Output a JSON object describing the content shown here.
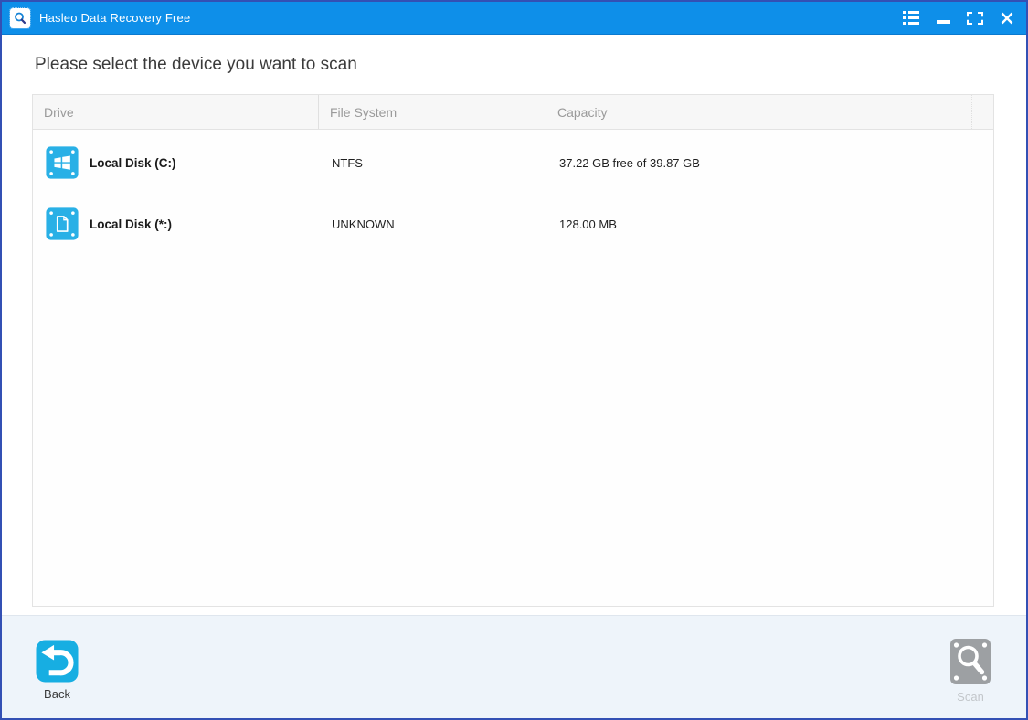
{
  "window": {
    "title": "Hasleo Data Recovery Free",
    "controls": [
      {
        "name": "menu-list-button"
      },
      {
        "name": "minimize-button"
      },
      {
        "name": "maximize-button"
      },
      {
        "name": "close-button"
      }
    ],
    "app_icon": "magnifier-app-icon"
  },
  "heading": "Please select the device you want to scan",
  "table": {
    "columns": [
      "Drive",
      "File System",
      "Capacity"
    ],
    "rows": [
      {
        "icon": "windows-drive-icon",
        "drive": "Local Disk (C:)",
        "file_system": "NTFS",
        "capacity": "37.22 GB free of 39.87 GB"
      },
      {
        "icon": "unknown-partition-icon",
        "drive": "Local Disk (*:)",
        "file_system": "UNKNOWN",
        "capacity": "128.00 MB"
      }
    ]
  },
  "footer": {
    "back_label": "Back",
    "scan_label": "Scan",
    "scan_enabled": false
  },
  "colors": {
    "titlebar_blue": "#0e8fe9",
    "accent_cyan": "#29b0e6",
    "window_border": "#3350b4",
    "disabled_gray": "#9da0a3",
    "footer_bg": "#eef4fa"
  }
}
